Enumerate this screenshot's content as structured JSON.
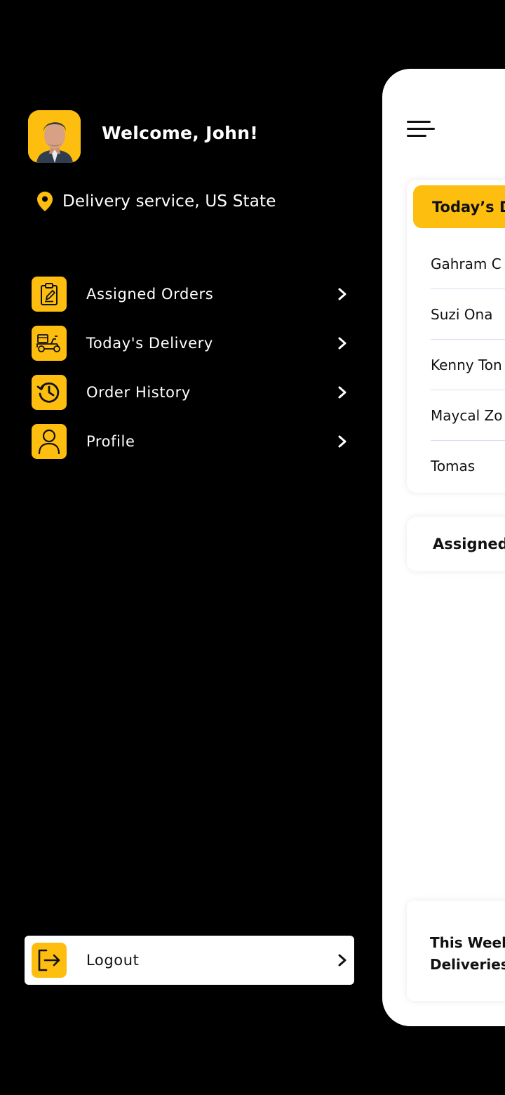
{
  "colors": {
    "accent": "#FDBE10",
    "background": "#000000",
    "card": "#FFFFFF"
  },
  "user": {
    "welcome": "Welcome, John!",
    "location": "Delivery service, US State"
  },
  "menu": {
    "items": [
      {
        "label": "Assigned Orders",
        "icon": "clipboard-edit-icon"
      },
      {
        "label": "Today's Delivery",
        "icon": "delivery-scooter-icon"
      },
      {
        "label": "Order History",
        "icon": "history-clock-icon"
      },
      {
        "label": "Profile",
        "icon": "user-icon"
      }
    ],
    "logout": {
      "label": "Logout",
      "icon": "logout-icon"
    }
  },
  "main": {
    "todays_delivery": {
      "header": "Today’s D",
      "rows": [
        "Gahram C",
        "Suzi Ona",
        "Kenny Ton",
        "Maycal Zo",
        "Tomas"
      ]
    },
    "assigned_header": "Assigned",
    "this_week": {
      "line1": "This Week",
      "line2": "Deliveries"
    }
  }
}
